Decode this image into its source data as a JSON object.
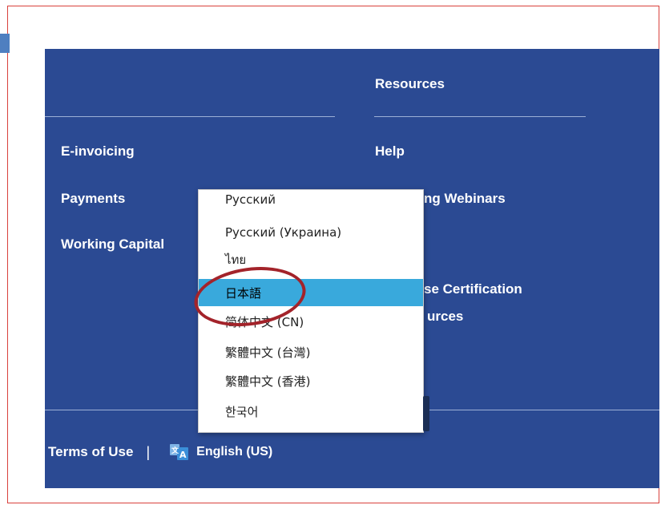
{
  "footer": {
    "resources_heading": "Resources",
    "left_links": [
      "E-invoicing",
      "Payments",
      "Working Capital"
    ],
    "right_links": [
      "Help",
      "ng Webinars",
      "se Certification",
      "urces"
    ],
    "terms": "Terms of Use",
    "separator": "|",
    "language_button": "English (US)"
  },
  "language_dropdown": {
    "options": [
      "Русский",
      "Русский (Украина)",
      "ไทย",
      "日本語",
      "简体中文 (CN)",
      "繁體中文 (台灣)",
      "繁體中文 (香港)",
      "한국어"
    ],
    "highlighted": "日本語"
  },
  "colors": {
    "footer_bg": "#2b4a93",
    "highlight": "#39a9dc",
    "annotation": "#a3232a",
    "frame": "#d9413c"
  }
}
